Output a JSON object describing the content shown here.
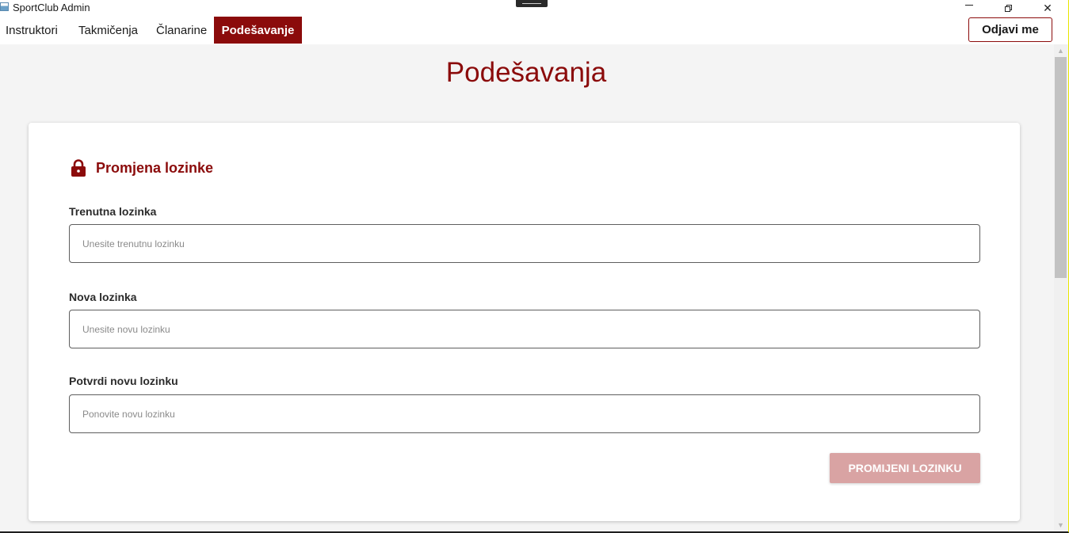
{
  "window": {
    "title": "SportClub Admin",
    "minimize_icon": "minimize-icon",
    "maximize_icon": "restore-icon",
    "close_glyph": "✕"
  },
  "nav": {
    "tabs": [
      {
        "label": "Instruktori",
        "active": false
      },
      {
        "label": "Takmičenja",
        "active": false
      },
      {
        "label": "Članarine",
        "active": false
      },
      {
        "label": "Podešavanje",
        "active": true
      }
    ],
    "logout_label": "Odjavi me"
  },
  "page": {
    "title": "Podešavanja"
  },
  "password_section": {
    "icon": "lock-icon",
    "title": "Promjena lozinke",
    "fields": [
      {
        "label": "Trenutna lozinka",
        "placeholder": "Unesite trenutnu lozinku",
        "value": ""
      },
      {
        "label": "Nova lozinka",
        "placeholder": "Unesite novu lozinku",
        "value": ""
      },
      {
        "label": "Potvrdi novu lozinku",
        "placeholder": "Ponovite novu lozinku",
        "value": ""
      }
    ],
    "submit_label": "PROMIJENI LOZINKU",
    "submit_enabled": false
  },
  "colors": {
    "accent": "#8b0b0b",
    "button_disabled": "#d9a3a3",
    "background": "#f4f4f4"
  }
}
